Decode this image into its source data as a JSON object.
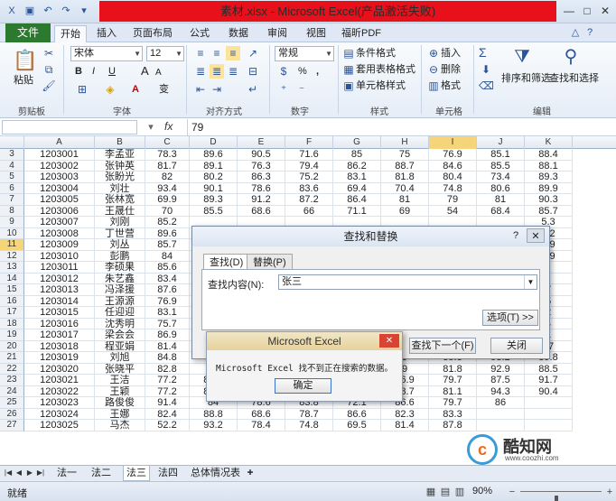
{
  "window": {
    "title": "素材.xlsx - Microsoft Excel(产品激活失败)",
    "qa_icons": [
      "excel-logo-icon",
      "save-icon",
      "undo-icon",
      "redo-icon",
      "customize-icon"
    ],
    "controls": [
      "minimize",
      "maximize",
      "close"
    ]
  },
  "ribbon_tabs": {
    "file": "文件",
    "tabs": [
      "开始",
      "插入",
      "页面布局",
      "公式",
      "数据",
      "审阅",
      "视图",
      "福昕PDF"
    ],
    "active": 0
  },
  "ribbon": {
    "clipboard": {
      "label": "剪贴板",
      "paste": "粘贴"
    },
    "font": {
      "label": "字体",
      "name": "宋体",
      "size": "12",
      "bold": "B",
      "italic": "I",
      "underline": "U",
      "grow": "A",
      "shrink": "A",
      "wen": "变"
    },
    "alignment": {
      "label": "对齐方式"
    },
    "number": {
      "label": "数字",
      "format": "常规",
      "percent": "%",
      "comma": ","
    },
    "styles": {
      "label": "样式",
      "items": [
        "条件格式",
        "套用表格格式",
        "单元格样式"
      ]
    },
    "cells": {
      "label": "单元格",
      "items": [
        "插入",
        "删除",
        "格式"
      ]
    },
    "editing": {
      "label": "编辑",
      "sort": "排序和筛选",
      "find": "查找和选择",
      "sum": "Σ"
    }
  },
  "formula_bar": {
    "fx": "fx",
    "value": "79"
  },
  "columns": [
    "A",
    "B",
    "C",
    "D",
    "E",
    "F",
    "G",
    "H",
    "I",
    "J",
    "K"
  ],
  "selected_col": "I",
  "selected_row": "11",
  "rows": [
    {
      "n": "3",
      "cells": [
        "1203001",
        "李孟亚",
        "78.3",
        "89.6",
        "90.5",
        "71.6",
        "85",
        "75",
        "76.9",
        "85.1",
        "88.4"
      ]
    },
    {
      "n": "4",
      "cells": [
        "1203002",
        "张钟英",
        "81.7",
        "89.1",
        "76.3",
        "79.4",
        "86.2",
        "88.7",
        "84.6",
        "85.5",
        "88.1"
      ]
    },
    {
      "n": "5",
      "cells": [
        "1203003",
        "张盼光",
        "82",
        "80.2",
        "86.3",
        "75.2",
        "83.1",
        "81.8",
        "80.4",
        "73.4",
        "89.3"
      ]
    },
    {
      "n": "6",
      "cells": [
        "1203004",
        "刘壮",
        "93.4",
        "90.1",
        "78.6",
        "83.6",
        "69.4",
        "70.4",
        "74.8",
        "80.6",
        "89.9"
      ]
    },
    {
      "n": "7",
      "cells": [
        "1203005",
        "张林宽",
        "69.9",
        "89.3",
        "91.2",
        "87.2",
        "86.4",
        "81",
        "79",
        "81",
        "90.3"
      ]
    },
    {
      "n": "8",
      "cells": [
        "1203006",
        "王晟仕",
        "70",
        "85.5",
        "68.6",
        "66",
        "71.1",
        "69",
        "54",
        "68.4",
        "85.7"
      ]
    },
    {
      "n": "9",
      "cells": [
        "1203007",
        "刘刚",
        "85.2",
        "",
        "",
        "",
        "",
        "",
        "",
        "",
        "5.3"
      ]
    },
    {
      "n": "10",
      "cells": [
        "1203008",
        "丁世营",
        "89.6",
        "",
        "",
        "",
        "",
        "",
        "",
        "",
        "6.2"
      ]
    },
    {
      "n": "11",
      "cells": [
        "1203009",
        "刘丛",
        "85.7",
        "",
        "",
        "",
        "",
        "",
        "",
        "",
        "5.9"
      ]
    },
    {
      "n": "12",
      "cells": [
        "1203010",
        "彭鹏",
        "84",
        "",
        "",
        "",
        "",
        "",
        "",
        "",
        "7.9"
      ]
    },
    {
      "n": "13",
      "cells": [
        "1203011",
        "李硕果",
        "85.6",
        "",
        "",
        "",
        "",
        "",
        "",
        "",
        ""
      ]
    },
    {
      "n": "14",
      "cells": [
        "1203012",
        "朱艺鑫",
        "83.4",
        "",
        "",
        "",
        "",
        "",
        "",
        "",
        ""
      ]
    },
    {
      "n": "15",
      "cells": [
        "1203013",
        "冯泽援",
        "87.6",
        "",
        "",
        "",
        "",
        "",
        "",
        "",
        "7"
      ]
    },
    {
      "n": "16",
      "cells": [
        "1203014",
        "王源源",
        "76.9",
        "",
        "",
        "",
        "",
        "",
        "",
        "",
        "5"
      ]
    },
    {
      "n": "17",
      "cells": [
        "1203015",
        "任迎迎",
        "83.1",
        "",
        "",
        "",
        "",
        "",
        "",
        "",
        "2"
      ]
    },
    {
      "n": "18",
      "cells": [
        "1203016",
        "沈秀明",
        "75.7",
        "",
        "",
        "",
        "",
        "",
        "",
        "",
        "4"
      ]
    },
    {
      "n": "19",
      "cells": [
        "1203017",
        "梁会会",
        "86.9",
        "",
        "",
        "",
        "",
        "",
        "",
        "",
        "1"
      ]
    },
    {
      "n": "20",
      "cells": [
        "1203018",
        "程亚娟",
        "81.4",
        "8",
        "",
        "",
        "",
        "",
        "93.9",
        "91.1",
        "87"
      ]
    },
    {
      "n": "21",
      "cells": [
        "1203019",
        "刘旭",
        "84.8",
        "8",
        "",
        "",
        "",
        "9",
        "85.3",
        "93.2",
        "89.8"
      ]
    },
    {
      "n": "22",
      "cells": [
        "1203020",
        "张晓平",
        "82.8",
        "8",
        "",
        "",
        "",
        "9",
        "81.8",
        "92.9",
        "88.5"
      ]
    },
    {
      "n": "23",
      "cells": [
        "1203021",
        "王洁",
        "77.2",
        "89.5",
        "86.3",
        "73.1",
        "82.9",
        "76.9",
        "79.7",
        "87.5",
        "91.7"
      ]
    },
    {
      "n": "24",
      "cells": [
        "1203022",
        "王颖",
        "77.2",
        "84.8",
        "85.6",
        "80.1",
        "72.5",
        "88.7",
        "81.1",
        "94.3",
        "90.4"
      ]
    },
    {
      "n": "25",
      "cells": [
        "1203023",
        "路俊俊",
        "91.4",
        "84",
        "78.6",
        "83.8",
        "72.1",
        "86.6",
        "79.7",
        "86",
        ""
      ]
    },
    {
      "n": "26",
      "cells": [
        "1203024",
        "王娜",
        "82.4",
        "88.8",
        "68.6",
        "78.7",
        "86.6",
        "82.3",
        "83.3",
        "",
        ""
      ]
    },
    {
      "n": "27",
      "cells": [
        "1203025",
        "马杰",
        "52.2",
        "93.2",
        "78.4",
        "74.8",
        "69.5",
        "81.4",
        "87.8",
        "",
        ""
      ]
    }
  ],
  "sheet_tabs": [
    "法一",
    "法二",
    "法三",
    "法四",
    "总体情况表"
  ],
  "active_sheet": 2,
  "status": {
    "text": "就绪",
    "zoom": "90%",
    "zoom_level": 0.9
  },
  "find_dialog": {
    "title": "查找和替换",
    "help": "?",
    "close": "✕",
    "tab_find": "查找(D)",
    "tab_replace": "替换(P)",
    "find_label": "查找内容(N):",
    "find_value": "张三",
    "options_button": "选项(T) >>",
    "find_next_button": "查找下一个(F)",
    "close_button": "关闭"
  },
  "message_box": {
    "title": "Microsoft Excel",
    "close": "✕",
    "message": "Microsoft Excel 找不到正在搜索的数据。",
    "ok_button": "确定"
  },
  "watermark": {
    "logo": "c",
    "name": "酷知网",
    "url": "www.coozhi.com"
  }
}
